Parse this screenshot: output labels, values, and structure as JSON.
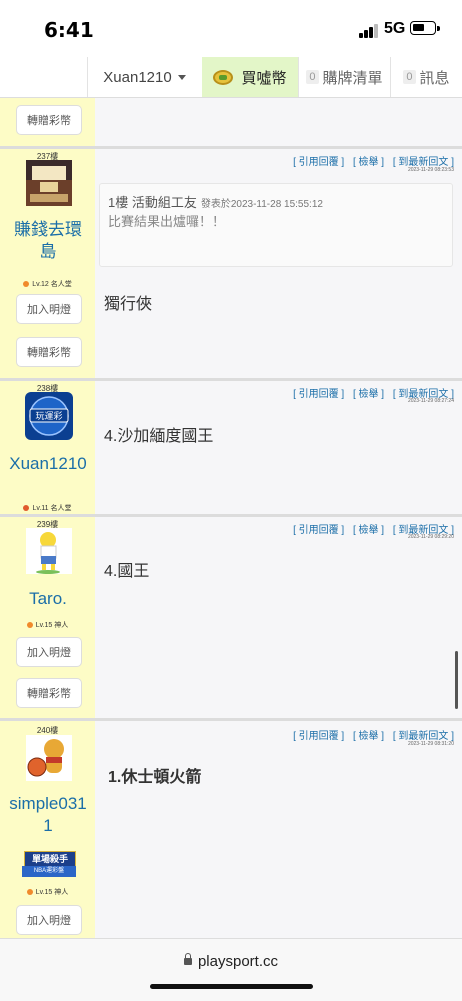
{
  "status": {
    "time": "6:41",
    "network": "5G"
  },
  "nav": {
    "user": "Xuan1210",
    "buy": "買噓幣",
    "cart_count": "0",
    "cart": "購牌清單",
    "msg_count": "0",
    "msg": "訊息"
  },
  "buttons": {
    "light": "加入明燈",
    "gift": "轉贈彩幣"
  },
  "actions": {
    "quote": "[ 引用回覆 ]",
    "report": "[ 檢舉 ]",
    "latest": "[ 到最新回文 ]"
  },
  "posts": [
    {
      "floor": "237樓",
      "user": "賺錢去環島",
      "level": "Lv.12 名人堂",
      "time": "2023-11-29 08:23:53",
      "quote_head": "1樓 活動組工友",
      "quote_meta": "發表於2023-11-28 15:55:12",
      "quote_body": "比賽結果出爐囉！！",
      "text": "獨行俠"
    },
    {
      "floor": "238樓",
      "user": "Xuan1210",
      "level": "Lv.11 名人堂",
      "time": "2023-11-29 08:27:24",
      "text": "4.沙加緬度國王"
    },
    {
      "floor": "239樓",
      "user": "Taro.",
      "level": "Lv.15 神人",
      "time": "2023-11-29 08:29:20",
      "text": "4.國王"
    },
    {
      "floor": "240樓",
      "user": "simple0311",
      "level": "Lv.15 神人",
      "badge_title": "單場殺手",
      "badge_sub": "NBA運彩盤",
      "time": "2023-11-29 08:31:20",
      "text": "1.休士頓火箭"
    }
  ],
  "url": "playsport.cc"
}
